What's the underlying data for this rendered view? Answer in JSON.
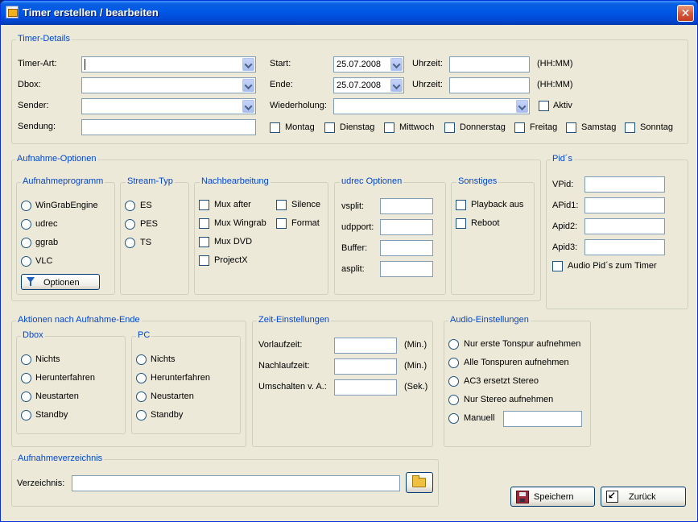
{
  "window": {
    "title": "Timer erstellen / bearbeiten",
    "close_glyph": "✕"
  },
  "timer": {
    "legend": "Timer-Details",
    "timer_art_label": "Timer-Art:",
    "timer_art_value": "",
    "dbox_label": "Dbox:",
    "dbox_value": "",
    "sender_label": "Sender:",
    "sender_value": "",
    "sendung_label": "Sendung:",
    "sendung_value": "",
    "start_label": "Start:",
    "start_date": "25.07.2008",
    "ende_label": "Ende:",
    "ende_date": "25.07.2008",
    "uhrzeit_label": "Uhrzeit:",
    "start_time": "",
    "ende_time": "",
    "hhmm_hint": "(HH:MM)",
    "wiederholung_label": "Wiederholung:",
    "wiederholung_value": "",
    "aktiv_label": "Aktiv",
    "days": [
      "Montag",
      "Dienstag",
      "Mittwoch",
      "Donnerstag",
      "Freitag",
      "Samstag",
      "Sonntag"
    ]
  },
  "aufnahme": {
    "legend": "Aufnahme-Optionen",
    "programm_legend": "Aufnahmeprogramm",
    "programme": [
      "WinGrabEngine",
      "udrec",
      "ggrab",
      "VLC"
    ],
    "optionen_button": "Optionen",
    "stream_legend": "Stream-Typ",
    "streams": [
      "ES",
      "PES",
      "TS"
    ],
    "nach_legend": "Nachbearbeitung",
    "nach_left": [
      "Mux after",
      "Mux Wingrab",
      "Mux DVD",
      "ProjectX"
    ],
    "nach_right": [
      "Silence",
      "Format"
    ],
    "udrec_legend": "udrec Optionen",
    "udrec_fields": [
      "vsplit:",
      "udpport:",
      "Buffer:",
      "asplit:"
    ],
    "sonstiges_legend": "Sonstiges",
    "sonstiges": [
      "Playback aus",
      "Reboot"
    ]
  },
  "pids": {
    "legend": "Pid´s",
    "fields": [
      "VPid:",
      "APid1:",
      "Apid2:",
      "Apid3:"
    ],
    "audio_checkbox": "Audio Pid´s zum Timer"
  },
  "aktionen": {
    "legend": "Aktionen nach Aufnahme-Ende",
    "dbox_legend": "Dbox",
    "pc_legend": "PC",
    "options": [
      "Nichts",
      "Herunterfahren",
      "Neustarten",
      "Standby"
    ]
  },
  "zeit": {
    "legend": "Zeit-Einstellungen",
    "vorlauf_label": "Vorlaufzeit:",
    "nachlauf_label": "Nachlaufzeit:",
    "umschalten_label": "Umschalten v. A.:",
    "min_unit": "(Min.)",
    "sek_unit": "(Sek.)"
  },
  "audio": {
    "legend": "Audio-Einstellungen",
    "options": [
      "Nur erste Tonspur aufnehmen",
      "Alle Tonspuren aufnehmen",
      "AC3 ersetzt Stereo",
      "Nur Stereo aufnehmen",
      "Manuell"
    ]
  },
  "verzeichnis": {
    "legend": "Aufnahmeverzeichnis",
    "label": "Verzeichnis:",
    "value": ""
  },
  "buttons": {
    "speichern": "Speichern",
    "zurueck": "Zurück"
  },
  "icons": {
    "app": "timer-app-icon",
    "filter": "filter-icon",
    "folder": "folder-open-icon",
    "save": "floppy-disk-icon",
    "back": "back-arrow-icon"
  }
}
